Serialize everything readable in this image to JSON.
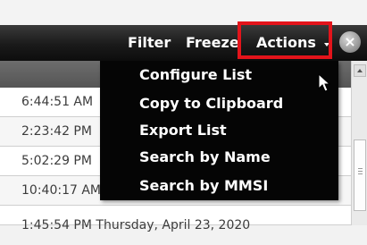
{
  "toolbar": {
    "filter_label": "Filter",
    "freeze_label": "Freeze",
    "actions_label": "Actions",
    "close_symbol": "×"
  },
  "actions_menu": {
    "items": [
      {
        "label": "Configure List"
      },
      {
        "label": "Copy to Clipboard"
      },
      {
        "label": "Export List"
      },
      {
        "label": "Search by Name"
      },
      {
        "label": "Search by MMSI"
      }
    ]
  },
  "grid": {
    "rows": [
      {
        "time": "6:44:51 AM"
      },
      {
        "time": "2:23:42 PM"
      },
      {
        "time": "5:02:29 PM"
      },
      {
        "time": "10:40:17 AM"
      },
      {
        "time": "1:45:54 PM Thursday, April 23, 2020"
      }
    ]
  },
  "colors": {
    "highlight": "#e3141b",
    "toolbar_bg": "#1a1a1a",
    "menu_bg": "#050505"
  }
}
